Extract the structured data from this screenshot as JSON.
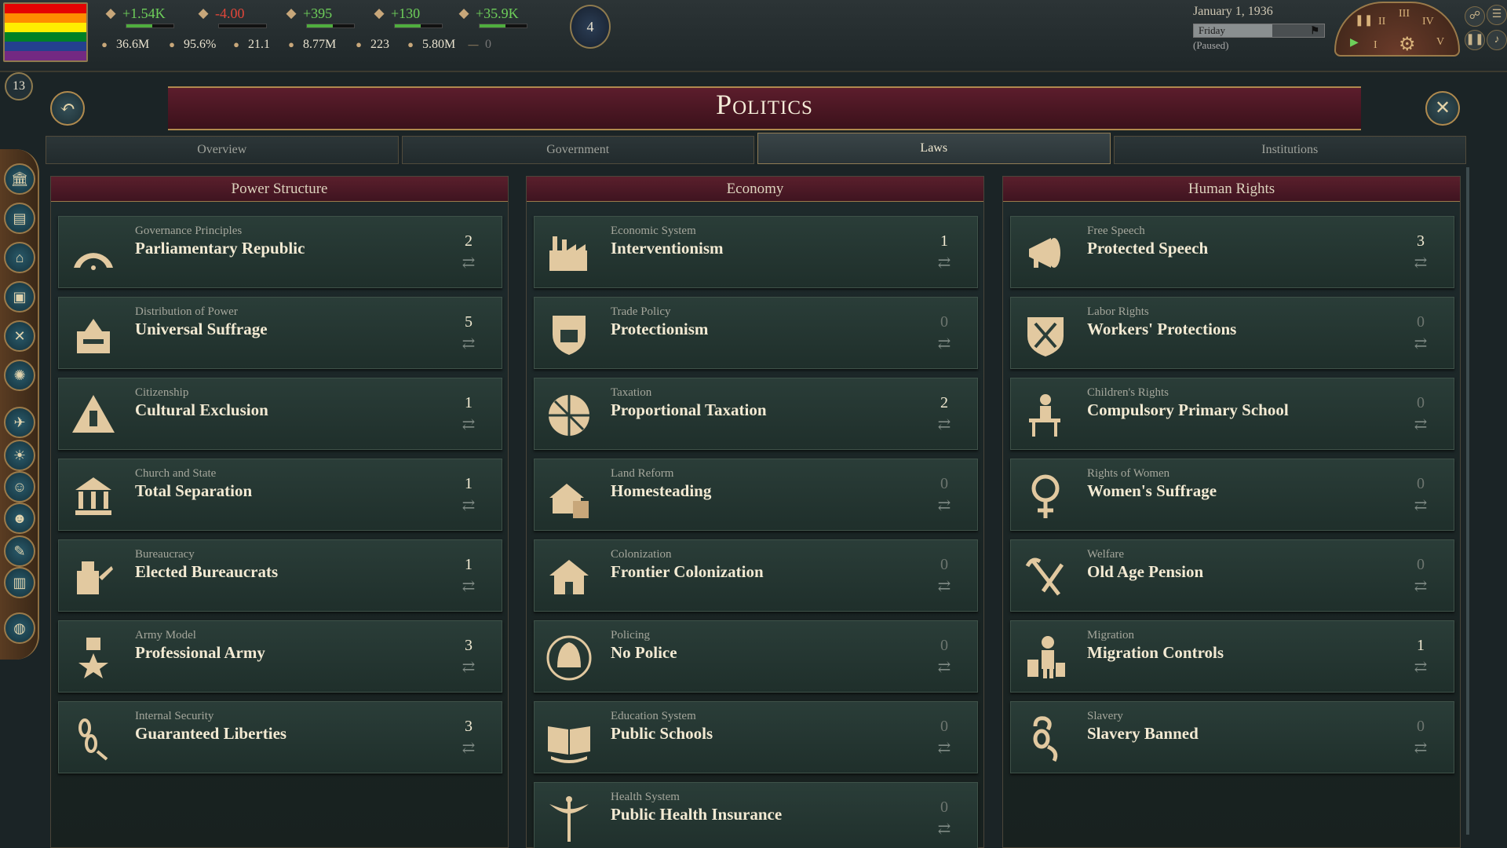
{
  "topbar": {
    "stats_top": [
      {
        "icon": "authority-icon",
        "value": "+1.54K",
        "tone": "pos"
      },
      {
        "icon": "bureaucracy-icon",
        "value": "-4.00",
        "tone": "neg"
      },
      {
        "icon": "influence-icon",
        "value": "+395",
        "tone": "pos"
      },
      {
        "icon": "convoy-icon",
        "value": "+130",
        "tone": "pos"
      },
      {
        "icon": "treasury-icon",
        "value": "+35.9K",
        "tone": "pos"
      }
    ],
    "stats_bottom": [
      {
        "icon": "gdp-icon",
        "value": "36.6M"
      },
      {
        "icon": "literacy-icon",
        "value": "95.6%"
      },
      {
        "icon": "standard-of-living-icon",
        "value": "21.1"
      },
      {
        "icon": "population-icon",
        "value": "8.77M"
      },
      {
        "icon": "army-icon",
        "value": "223"
      },
      {
        "icon": "prestige-icon",
        "value": "5.80M"
      },
      {
        "icon": "zero-counter-icon",
        "value": "0"
      }
    ],
    "day_marker": "4",
    "date": "January 1, 1936",
    "weekday": "Friday",
    "paused": "(Paused)",
    "speed_labels": [
      "II",
      "III",
      "IV",
      "V",
      "I"
    ],
    "turn_badge": "13"
  },
  "panel": {
    "title": "Politics",
    "back_label": "↶",
    "close_label": "✕",
    "tabs": [
      {
        "label": "Overview"
      },
      {
        "label": "Government"
      },
      {
        "label": "Laws"
      },
      {
        "label": "Institutions"
      }
    ],
    "active_tab": "Laws"
  },
  "columns": [
    {
      "header": "Power Structure",
      "laws": [
        {
          "category": "Governance Principles",
          "name": "Parliamentary Republic",
          "count": "2",
          "icon": "parliament-icon"
        },
        {
          "category": "Distribution of Power",
          "name": "Universal Suffrage",
          "count": "5",
          "icon": "ballot-box-icon"
        },
        {
          "category": "Citizenship",
          "name": "Cultural Exclusion",
          "count": "1",
          "icon": "raised-hand-icon"
        },
        {
          "category": "Church and State",
          "name": "Total Separation",
          "count": "1",
          "icon": "courthouse-icon"
        },
        {
          "category": "Bureaucracy",
          "name": "Elected Bureaucrats",
          "count": "1",
          "icon": "ballot-scroll-icon"
        },
        {
          "category": "Army Model",
          "name": "Professional Army",
          "count": "3",
          "icon": "medal-star-icon"
        },
        {
          "category": "Internal Security",
          "name": "Guaranteed Liberties",
          "count": "3",
          "icon": "broken-chain-icon"
        }
      ]
    },
    {
      "header": "Economy",
      "laws": [
        {
          "category": "Economic System",
          "name": "Interventionism",
          "count": "1",
          "icon": "factory-icon"
        },
        {
          "category": "Trade Policy",
          "name": "Protectionism",
          "count": "0",
          "icon": "shield-factory-icon"
        },
        {
          "category": "Taxation",
          "name": "Proportional Taxation",
          "count": "2",
          "icon": "pie-chart-icon"
        },
        {
          "category": "Land Reform",
          "name": "Homesteading",
          "count": "0",
          "icon": "land-pound-icon"
        },
        {
          "category": "Colonization",
          "name": "Frontier Colonization",
          "count": "0",
          "icon": "house-icon"
        },
        {
          "category": "Policing",
          "name": "No Police",
          "count": "0",
          "icon": "police-helmet-icon"
        },
        {
          "category": "Education System",
          "name": "Public Schools",
          "count": "0",
          "icon": "open-book-icon"
        },
        {
          "category": "Health System",
          "name": "Public Health Insurance",
          "count": "0",
          "icon": "caduceus-icon"
        }
      ]
    },
    {
      "header": "Human Rights",
      "laws": [
        {
          "category": "Free Speech",
          "name": "Protected Speech",
          "count": "3",
          "icon": "megaphone-icon"
        },
        {
          "category": "Labor Rights",
          "name": "Workers' Protections",
          "count": "0",
          "icon": "tools-shield-icon"
        },
        {
          "category": "Children's Rights",
          "name": "Compulsory Primary School",
          "count": "0",
          "icon": "school-desk-icon"
        },
        {
          "category": "Rights of Women",
          "name": "Women's Suffrage",
          "count": "0",
          "icon": "venus-icon"
        },
        {
          "category": "Welfare",
          "name": "Old Age Pension",
          "count": "0",
          "icon": "cane-icon"
        },
        {
          "category": "Migration",
          "name": "Migration Controls",
          "count": "1",
          "icon": "migrant-icon"
        },
        {
          "category": "Slavery",
          "name": "Slavery Banned",
          "count": "0",
          "icon": "broken-shackle-icon"
        }
      ]
    }
  ],
  "swap_glyph": "⇄",
  "colors": {
    "positive": "#6ecf5a",
    "negative": "#e0463a",
    "banner": "#5c1d2c",
    "card": "#2a3d38",
    "gold": "#b08a4e"
  }
}
